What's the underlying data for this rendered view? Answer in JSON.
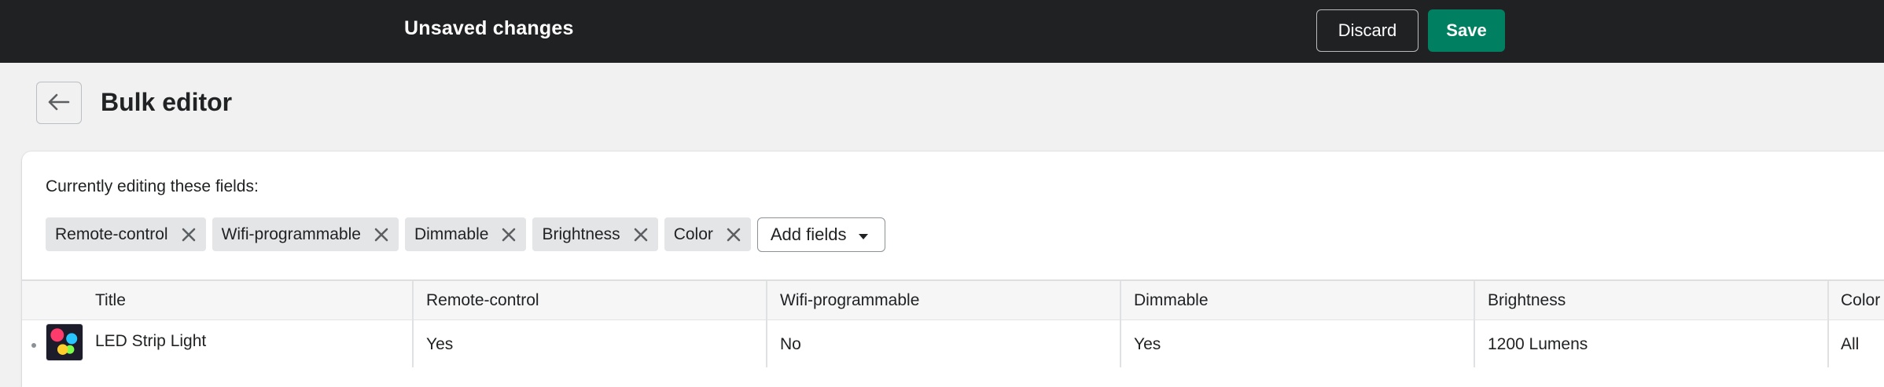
{
  "topbar": {
    "title": "Unsaved changes",
    "discard_label": "Discard",
    "save_label": "Save"
  },
  "page": {
    "title": "Bulk editor",
    "back_icon": "arrow-left-icon"
  },
  "editing": {
    "label": "Currently editing these fields:",
    "tags": [
      "Remote-control",
      "Wifi-programmable",
      "Dimmable",
      "Brightness",
      "Color"
    ],
    "add_fields_label": "Add fields"
  },
  "table": {
    "headers": [
      "Title",
      "Remote-control",
      "Wifi-programmable",
      "Dimmable",
      "Brightness",
      "Color"
    ],
    "rows": [
      {
        "title": "LED Strip Light",
        "remote_control": "Yes",
        "wifi_programmable": "No",
        "dimmable": "Yes",
        "brightness": "1200 Lumens",
        "color": "All"
      }
    ]
  },
  "colors": {
    "topbar_bg": "#202123",
    "save_bg": "#008060",
    "tag_bg": "#e4e5e7"
  }
}
